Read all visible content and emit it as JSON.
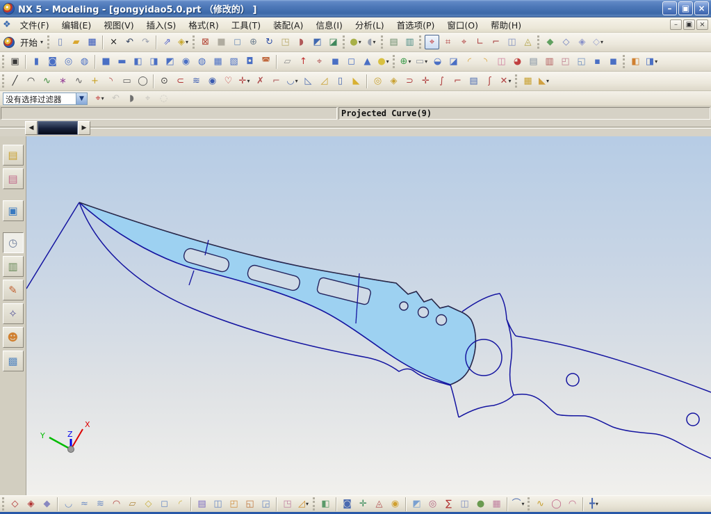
{
  "window": {
    "title": "NX 5 - Modeling - [gongyidao5.0.prt （修改的） ]",
    "controls": [
      {
        "name": "minimize-button",
        "glyph": "–"
      },
      {
        "name": "restore-button",
        "glyph": "▣"
      },
      {
        "name": "close-button",
        "glyph": "×"
      }
    ],
    "mdi_controls": [
      {
        "name": "child-minimize-button",
        "glyph": "–"
      },
      {
        "name": "child-restore-button",
        "glyph": "▣"
      },
      {
        "name": "child-close-button",
        "glyph": "×"
      }
    ]
  },
  "menu": {
    "items": [
      {
        "name": "menu-file",
        "label": "文件(F)"
      },
      {
        "name": "menu-edit",
        "label": "编辑(E)"
      },
      {
        "name": "menu-view",
        "label": "视图(V)"
      },
      {
        "name": "menu-insert",
        "label": "插入(S)"
      },
      {
        "name": "menu-format",
        "label": "格式(R)"
      },
      {
        "name": "menu-tools",
        "label": "工具(T)"
      },
      {
        "name": "menu-assemblies",
        "label": "装配(A)"
      },
      {
        "name": "menu-information",
        "label": "信息(I)"
      },
      {
        "name": "menu-analysis",
        "label": "分析(L)"
      },
      {
        "name": "menu-preferences",
        "label": "首选项(P)"
      },
      {
        "name": "menu-window",
        "label": "窗口(O)"
      },
      {
        "name": "menu-help",
        "label": "帮助(H)"
      }
    ]
  },
  "toolbars": {
    "start_label": "开始",
    "row1": [
      {
        "grip": true
      },
      {
        "name": "new-file",
        "glyph": "▯",
        "color": "#7488bb"
      },
      {
        "name": "open-file",
        "glyph": "▰",
        "color": "#d9a62e"
      },
      {
        "name": "save-file",
        "glyph": "▦",
        "color": "#3355bb"
      },
      {
        "sep": true
      },
      {
        "name": "delete",
        "glyph": "×",
        "color": "#1a1a1a"
      },
      {
        "name": "undo",
        "glyph": "↶",
        "color": "#33415f"
      },
      {
        "name": "redo",
        "glyph": "↷",
        "color": "#9aa0ae"
      },
      {
        "sep": true
      },
      {
        "name": "pan-rotate",
        "glyph": "⇗",
        "color": "#5566cc"
      },
      {
        "name": "info-tag",
        "glyph": "◈",
        "color": "#c8a830",
        "dropdown": true
      },
      {
        "grip": true
      },
      {
        "name": "fit-view",
        "glyph": "⊠",
        "color": "#b04030"
      },
      {
        "name": "highlight-area",
        "glyph": "■",
        "color": "#b0aca0"
      },
      {
        "name": "zoom-area",
        "glyph": "◻",
        "color": "#7090b8"
      },
      {
        "name": "zoom-in-out",
        "glyph": "⊕",
        "color": "#708090"
      },
      {
        "name": "rotate-view",
        "glyph": "↻",
        "color": "#3050a8"
      },
      {
        "name": "view-popup",
        "glyph": "◳",
        "color": "#b8a868"
      },
      {
        "name": "eraser-view",
        "glyph": "◗",
        "color": "#b05858"
      },
      {
        "name": "update-display",
        "glyph": "◩",
        "color": "#4068b0"
      },
      {
        "name": "regenerate-work",
        "glyph": "◪",
        "color": "#40885c"
      },
      {
        "grip": true
      },
      {
        "name": "shaded-ball",
        "glyph": "●",
        "color": "#a8b048",
        "dropdown": true
      },
      {
        "name": "rendering-style",
        "glyph": "◖",
        "color": "#9aa0ae",
        "dropdown": true
      },
      {
        "grip": true
      },
      {
        "name": "move-to-layer",
        "glyph": "▤",
        "color": "#6c8c6c"
      },
      {
        "name": "layer-visible-in-view",
        "glyph": "▥",
        "color": "#4c8c84"
      },
      {
        "grip": true
      },
      {
        "name": "wcs-dynamics",
        "glyph": "⌖",
        "color": "#c03030",
        "boxed": true
      },
      {
        "name": "wcs-rotate",
        "glyph": "⌗",
        "color": "#b03838"
      },
      {
        "name": "wcs-orient",
        "glyph": "⌖",
        "color": "#b04040"
      },
      {
        "name": "wcs-change-xc",
        "glyph": "∟",
        "color": "#b04848"
      },
      {
        "name": "wcs-change-yc",
        "glyph": "⌐",
        "color": "#a84040"
      },
      {
        "name": "wcs-save",
        "glyph": "◫",
        "color": "#8090c0"
      },
      {
        "name": "wcs-display",
        "glyph": "◬",
        "color": "#b0a040"
      },
      {
        "grip": true
      },
      {
        "name": "snap-layer-1",
        "glyph": "◆",
        "color": "#60a060"
      },
      {
        "name": "snap-layer-2",
        "glyph": "◇",
        "color": "#7080c0"
      },
      {
        "name": "snap-layer-3",
        "glyph": "◈",
        "color": "#8890c8"
      },
      {
        "name": "snap-layer-4",
        "glyph": "◇",
        "color": "#a0a8d0",
        "dropdown": true
      }
    ],
    "row2": [
      {
        "grip": true
      },
      {
        "name": "sketch",
        "glyph": "▣",
        "color": "#383838"
      },
      {
        "sep": true
      },
      {
        "name": "extrude",
        "glyph": "▮",
        "color": "#4a6fc4"
      },
      {
        "name": "revolve",
        "glyph": "◙",
        "color": "#4a6fc4"
      },
      {
        "name": "tube",
        "glyph": "◎",
        "color": "#4a6fc4"
      },
      {
        "name": "sweep-along-guide",
        "glyph": "◍",
        "color": "#4a6fc4"
      },
      {
        "sep": true
      },
      {
        "name": "block",
        "glyph": "■",
        "color": "#4a6fc4"
      },
      {
        "name": "cylinder",
        "glyph": "▬",
        "color": "#4a6fc4"
      },
      {
        "name": "boolean-unite",
        "glyph": "◧",
        "color": "#4a6fc4"
      },
      {
        "name": "boolean-subtract",
        "glyph": "◨",
        "color": "#4a6fc4"
      },
      {
        "name": "boolean-intersect",
        "glyph": "◩",
        "color": "#4a6fc4"
      },
      {
        "name": "hole",
        "glyph": "◉",
        "color": "#4a6fc4"
      },
      {
        "name": "boss",
        "glyph": "◍",
        "color": "#4a6fc4"
      },
      {
        "name": "pocket",
        "glyph": "▦",
        "color": "#4a6fc4"
      },
      {
        "name": "pad",
        "glyph": "▧",
        "color": "#4a6fc4"
      },
      {
        "name": "emboss",
        "glyph": "◘",
        "color": "#4a6fc4"
      },
      {
        "name": "body-trim",
        "glyph": "◚",
        "color": "#c06a40"
      },
      {
        "sep": true
      },
      {
        "name": "datum-plane",
        "glyph": "▱",
        "color": "#909090"
      },
      {
        "name": "datum-axis",
        "glyph": "↑",
        "color": "#c03030"
      },
      {
        "name": "datum-csys",
        "glyph": "⌖",
        "color": "#b05050"
      },
      {
        "name": "split-body",
        "glyph": "◼",
        "color": "#4a6fc4"
      },
      {
        "name": "trim-body",
        "glyph": "◻",
        "color": "#4a6fc4"
      },
      {
        "name": "cone",
        "glyph": "▲",
        "color": "#4a6fc4"
      },
      {
        "name": "sphere",
        "glyph": "●",
        "color": "#d8c040",
        "dropdown": true
      },
      {
        "grip": true
      },
      {
        "name": "point-set",
        "glyph": "⊕",
        "color": "#3a9a4a",
        "dropdown": true
      },
      {
        "name": "plane",
        "glyph": "▭",
        "color": "#9aa0a8",
        "dropdown": true
      },
      {
        "name": "edge-blend",
        "glyph": "◒",
        "color": "#4a6fc4"
      },
      {
        "name": "chamfer",
        "glyph": "◪",
        "color": "#4a6fc4"
      },
      {
        "name": "draft",
        "glyph": "◜",
        "color": "#d8a030"
      },
      {
        "name": "draft-body",
        "glyph": "◝",
        "color": "#d8a030"
      },
      {
        "name": "shell",
        "glyph": "◫",
        "color": "#d080a0"
      },
      {
        "name": "section-feature",
        "glyph": "◕",
        "color": "#c04040"
      },
      {
        "name": "thread",
        "glyph": "▤",
        "color": "#8090a0"
      },
      {
        "name": "instance-feature",
        "glyph": "▥",
        "color": "#b05858"
      },
      {
        "name": "mirror-feature",
        "glyph": "◰",
        "color": "#c08090"
      },
      {
        "name": "pattern-face",
        "glyph": "◱",
        "color": "#7090c0"
      },
      {
        "name": "offset-face",
        "glyph": "▪",
        "color": "#4a6fc4"
      },
      {
        "name": "scale-body",
        "glyph": "◼",
        "color": "#4a6fc4"
      },
      {
        "grip": true
      },
      {
        "name": "feature-group-a",
        "glyph": "◧",
        "color": "#d08030"
      },
      {
        "name": "feature-group-b",
        "glyph": "◨",
        "color": "#4a6fc4",
        "dropdown": true
      }
    ],
    "row3": [
      {
        "grip": true
      },
      {
        "name": "line",
        "glyph": "╱",
        "color": "#303030"
      },
      {
        "name": "arc",
        "glyph": "◠",
        "color": "#303030"
      },
      {
        "name": "studio-spline",
        "glyph": "∿",
        "color": "#3a8a3a"
      },
      {
        "name": "point-curve",
        "glyph": "∗",
        "color": "#9a4a9a"
      },
      {
        "name": "spline",
        "glyph": "∿",
        "color": "#606060"
      },
      {
        "name": "point",
        "glyph": "+",
        "color": "#c8a020"
      },
      {
        "name": "fillet-curve",
        "glyph": "◝",
        "color": "#b04040"
      },
      {
        "name": "rectangle",
        "glyph": "▭",
        "color": "#606060"
      },
      {
        "name": "polygon",
        "glyph": "◯",
        "color": "#505050"
      },
      {
        "sep": true
      },
      {
        "name": "ellipse",
        "glyph": "⊙",
        "color": "#404040"
      },
      {
        "name": "conic",
        "glyph": "⊂",
        "color": "#b03030"
      },
      {
        "name": "helix",
        "glyph": "≋",
        "color": "#3a5ab0"
      },
      {
        "name": "spiral",
        "glyph": "◉",
        "color": "#3a5ab0"
      },
      {
        "name": "profile-curve",
        "glyph": "♡",
        "color": "#c03030"
      },
      {
        "name": "point-pattern",
        "glyph": "✛",
        "color": "#b04040",
        "dropdown": true
      },
      {
        "name": "curve-trim",
        "glyph": "✗",
        "color": "#b05050"
      },
      {
        "name": "quick-extend",
        "glyph": "⌐",
        "color": "#b06060"
      },
      {
        "name": "bridge-curve",
        "glyph": "◡",
        "color": "#4a6ab0",
        "dropdown": true
      },
      {
        "name": "offset-curve",
        "glyph": "◺",
        "color": "#4a6ab0"
      },
      {
        "name": "join-curve",
        "glyph": "◿",
        "color": "#c8a030"
      },
      {
        "name": "wrap-curve",
        "glyph": "▯",
        "color": "#4a6ab0"
      },
      {
        "name": "simplify-curve",
        "glyph": "◣",
        "color": "#d8b030"
      },
      {
        "sep": true
      },
      {
        "name": "project-curve",
        "glyph": "◎",
        "color": "#c8a030"
      },
      {
        "name": "combine-projection",
        "glyph": "◈",
        "color": "#c8a030"
      },
      {
        "name": "intersect-curve",
        "glyph": "⊃",
        "color": "#b04040"
      },
      {
        "name": "section-curve",
        "glyph": "✛",
        "color": "#b04040"
      },
      {
        "name": "extract-curve",
        "glyph": "∫",
        "color": "#b04040"
      },
      {
        "name": "corner-curve",
        "glyph": "⌐",
        "color": "#b04040"
      },
      {
        "name": "sheet-curve",
        "glyph": "▤",
        "color": "#4a6ab0"
      },
      {
        "name": "law-curve",
        "glyph": "ʃ",
        "color": "#b04040"
      },
      {
        "name": "stretch-curve",
        "glyph": "✕",
        "color": "#b04040",
        "dropdown": true
      },
      {
        "grip": true
      },
      {
        "name": "dimension",
        "glyph": "▦",
        "color": "#c8a030"
      },
      {
        "name": "angle-dimension",
        "glyph": "◣",
        "color": "#d0a040",
        "dropdown": true
      }
    ],
    "bottom": [
      {
        "grip": true
      },
      {
        "name": "four-point-surface",
        "glyph": "◇",
        "color": "#b03030"
      },
      {
        "name": "swept-point-surface",
        "glyph": "◈",
        "color": "#b03030"
      },
      {
        "name": "section-point-surface",
        "glyph": "◆",
        "color": "#8888c0"
      },
      {
        "sep": true
      },
      {
        "name": "ruled-surface",
        "glyph": "◡",
        "color": "#6a8ac4"
      },
      {
        "name": "through-curves",
        "glyph": "≈",
        "color": "#6a8ac4"
      },
      {
        "name": "through-curve-mesh",
        "glyph": "≋",
        "color": "#6a8ac4"
      },
      {
        "name": "swept-surface",
        "glyph": "◠",
        "color": "#b04040"
      },
      {
        "name": "section-surface",
        "glyph": "▱",
        "color": "#b08840"
      },
      {
        "name": "n-sided-surface",
        "glyph": "◇",
        "color": "#c8b040"
      },
      {
        "name": "bounded-plane",
        "glyph": "◻",
        "color": "#6a8ac4"
      },
      {
        "name": "bridge-surface",
        "glyph": "◜",
        "color": "#d0b040"
      },
      {
        "sep": true
      },
      {
        "name": "offset-surface",
        "glyph": "▤",
        "color": "#7a6ac0"
      },
      {
        "name": "law-extension",
        "glyph": "◫",
        "color": "#6a8ac4"
      },
      {
        "name": "extension-surface",
        "glyph": "◰",
        "color": "#d09040"
      },
      {
        "name": "trimmed-sheet",
        "glyph": "◱",
        "color": "#c07840"
      },
      {
        "name": "trim-and-extend",
        "glyph": "◲",
        "color": "#6a8ac4"
      },
      {
        "sep": true
      },
      {
        "name": "sew-sheet",
        "glyph": "◳",
        "color": "#c080a0"
      },
      {
        "name": "snip-surface",
        "glyph": "◿",
        "color": "#d09030",
        "dropdown": true
      },
      {
        "grip": true
      },
      {
        "name": "quilt-surface",
        "glyph": "◧",
        "color": "#5a9a6a"
      },
      {
        "sep": true
      },
      {
        "name": "studio-surface",
        "glyph": "◙",
        "color": "#4a6ab0"
      },
      {
        "name": "x-form",
        "glyph": "✛",
        "color": "#3a8a5a"
      },
      {
        "name": "i-form",
        "glyph": "◬",
        "color": "#b05050"
      },
      {
        "name": "fill-surface",
        "glyph": "◉",
        "color": "#d0a030"
      },
      {
        "sep": true
      },
      {
        "name": "mesh-surface",
        "glyph": "◩",
        "color": "#7aa0d0"
      },
      {
        "name": "ribbon-builder",
        "glyph": "◎",
        "color": "#b06080"
      },
      {
        "name": "global-shaping",
        "glyph": "∑",
        "color": "#b03030"
      },
      {
        "name": "flange-surface",
        "glyph": "◫",
        "color": "#8090c0"
      },
      {
        "name": "shaded-analysis",
        "glyph": "●",
        "color": "#6a9a50"
      },
      {
        "name": "grid-analysis",
        "glyph": "▦",
        "color": "#c080a0"
      },
      {
        "sep": true
      },
      {
        "name": "edit-surface",
        "glyph": "⌒",
        "color": "#4a6ab0",
        "dropdown": true
      },
      {
        "grip": true
      },
      {
        "name": "fit-spline",
        "glyph": "∿",
        "color": "#c8a030"
      },
      {
        "name": "smooth-pole",
        "glyph": "◯",
        "color": "#c06a8a"
      },
      {
        "name": "dome-surface",
        "glyph": "◠",
        "color": "#c06a8a"
      },
      {
        "sep": true
      },
      {
        "name": "deviation-gauge",
        "glyph": "╋",
        "color": "#4a6ab0",
        "dropdown": true
      }
    ]
  },
  "selection_bar": {
    "filter_value": "没有选择过滤器",
    "icons": [
      {
        "name": "snap-point-filter",
        "glyph": "⌖",
        "color": "#c03030",
        "dropdown": true
      },
      {
        "name": "selection-undo",
        "glyph": "↶",
        "color": "#9a9a9a",
        "disabled": true
      },
      {
        "name": "deselect-eraser",
        "glyph": "◗",
        "color": "#707070"
      },
      {
        "name": "snap-point",
        "glyph": "⌖",
        "color": "#9a9a9a",
        "disabled": true
      },
      {
        "name": "snap-hand",
        "glyph": "◌",
        "color": "#9a9a9a",
        "disabled": true
      }
    ]
  },
  "status_bar": {
    "message": "Projected Curve(9)"
  },
  "sidebar": {
    "items": [
      {
        "name": "assembly-navigator",
        "glyph": "▤",
        "color": "#c8a030"
      },
      {
        "name": "constraint-navigator",
        "glyph": "▤",
        "color": "#c06a8a"
      },
      {
        "name": "part-navigator",
        "glyph": "▣",
        "color": "#3a7ac0",
        "gap": true
      },
      {
        "name": "history-palette",
        "glyph": "◷",
        "color": "#6a7a9a",
        "active": true,
        "gap": true
      },
      {
        "name": "information-notebook",
        "glyph": "▥",
        "color": "#6a8a5a"
      },
      {
        "name": "roles-palette",
        "glyph": "✎",
        "color": "#c06030"
      },
      {
        "name": "system-scenes",
        "glyph": "✧",
        "color": "#5a5a9a"
      },
      {
        "name": "user-roles",
        "glyph": "☻",
        "color": "#d08030"
      },
      {
        "name": "web-browser",
        "glyph": "▩",
        "color": "#5a8ac0"
      }
    ]
  },
  "scrollbar": {
    "left_arrow": "◀",
    "right_arrow": "▶"
  },
  "viewport": {
    "triad": {
      "x": "X",
      "y": "Y",
      "z": "Z"
    },
    "colors": {
      "curve_line": "#1414a0",
      "solid_edge": "#2e2e38",
      "selected_face_fill": "#9dd1f1",
      "background_top": "#b6cce5",
      "background_bottom": "#f1f0ed",
      "triad_x": "#dd0000",
      "triad_y": "#00bb00",
      "triad_z": "#0000ee"
    }
  }
}
